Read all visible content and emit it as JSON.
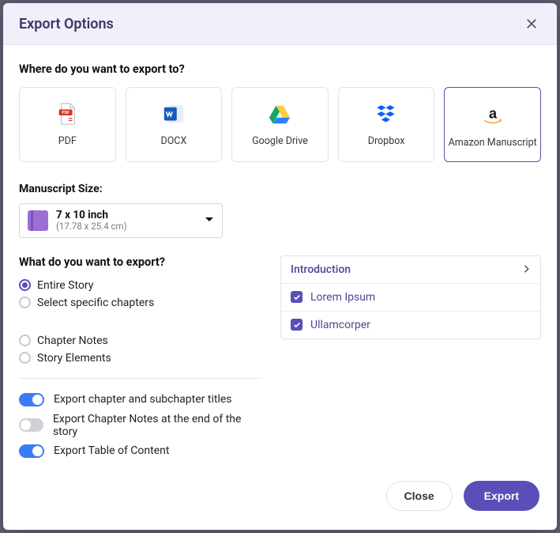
{
  "header": {
    "title": "Export Options"
  },
  "export": {
    "question": "Where do you want to export to?",
    "options": {
      "pdf": "PDF",
      "docx": "DOCX",
      "gdrive": "Google Drive",
      "dropbox": "Dropbox",
      "amazon": "Amazon Manuscript"
    },
    "selected": "amazon"
  },
  "size": {
    "label": "Manuscript Size:",
    "main": "7 x 10 inch",
    "sub": "(17.78 x 25.4 cm)"
  },
  "scope": {
    "question": "What do you want to export?",
    "entire": "Entire Story",
    "specific": "Select specific chapters",
    "notes": "Chapter Notes",
    "elements": "Story Elements"
  },
  "chapters": {
    "header": "Introduction",
    "item1": "Lorem Ipsum",
    "item2": "Ullamcorper"
  },
  "toggles": {
    "titles": "Export chapter and subchapter titles",
    "notes_end": "Export Chapter Notes at the end of the story",
    "toc": "Export Table of Content"
  },
  "footer": {
    "close": "Close",
    "export": "Export"
  }
}
